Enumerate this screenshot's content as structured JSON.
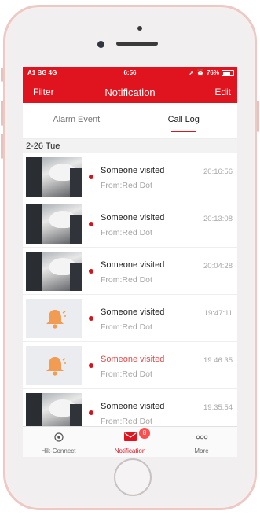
{
  "status_bar": {
    "carrier": "A1 BG  4G",
    "time": "6:56",
    "battery": "76%"
  },
  "nav": {
    "filter_label": "Filter",
    "title": "Notification",
    "edit_label": "Edit"
  },
  "tabs": [
    {
      "label": "Alarm Event",
      "active": false
    },
    {
      "label": "Call Log",
      "active": true
    }
  ],
  "date_header": "2-26 Tue",
  "call_log": [
    {
      "title": "Someone visited",
      "source": "From:Red Dot",
      "time": "20:16:56",
      "thumb": "camera-snapshot",
      "highlight": false
    },
    {
      "title": "Someone visited",
      "source": "From:Red Dot",
      "time": "20:13:08",
      "thumb": "camera-snapshot",
      "highlight": false
    },
    {
      "title": "Someone visited",
      "source": "From:Red Dot",
      "time": "20:04:28",
      "thumb": "camera-snapshot",
      "highlight": false
    },
    {
      "title": "Someone visited",
      "source": "From:Red Dot",
      "time": "19:47:11",
      "thumb": "bell-icon",
      "highlight": false
    },
    {
      "title": "Someone visited",
      "source": "From:Red Dot",
      "time": "19:46:35",
      "thumb": "bell-icon",
      "highlight": true
    },
    {
      "title": "Someone visited",
      "source": "From:Red Dot",
      "time": "19:35:54",
      "thumb": "camera-snapshot",
      "highlight": false
    }
  ],
  "tab_bar": [
    {
      "label": "Hik-Connect",
      "icon": "hik-connect-icon"
    },
    {
      "label": "Notification",
      "icon": "mail-icon",
      "badge": "8",
      "active": true
    },
    {
      "label": "More",
      "icon": "more-dots-icon"
    }
  ],
  "colors": {
    "accent": "#e0141e",
    "unread_dot": "#d2141e",
    "highlight_text": "#e34a4a",
    "bell_orange": "#f29b52"
  }
}
